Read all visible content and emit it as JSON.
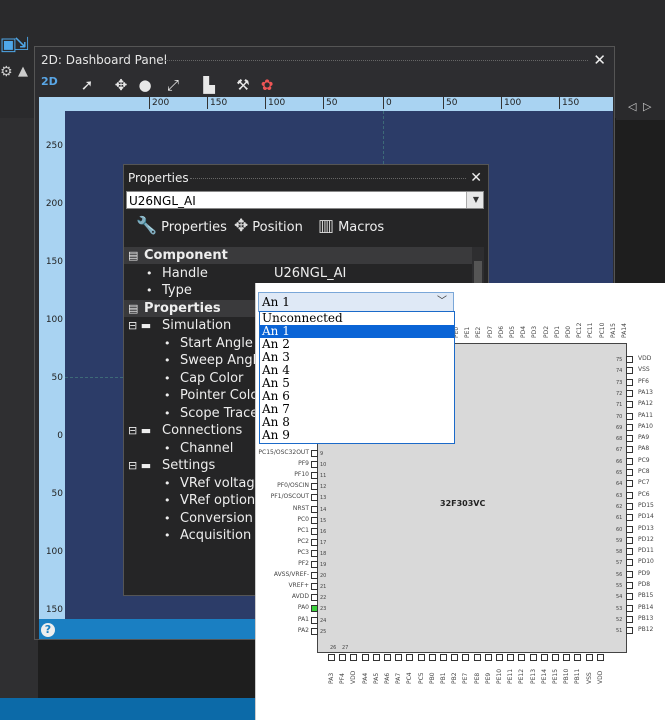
{
  "dashboard": {
    "title": "2D: Dashboard Panel",
    "mode_label": "2D",
    "close_label": "✕",
    "ruler_h_ticks": [
      "200",
      "150",
      "100",
      "50",
      "0",
      "50",
      "100",
      "150"
    ],
    "ruler_v_ticks": [
      "250",
      "200",
      "150",
      "100",
      "50",
      "0",
      "50",
      "100",
      "150"
    ],
    "help_label": "?"
  },
  "properties": {
    "title": "Properties",
    "close_label": "✕",
    "component": "U26NGL_AI",
    "tabs": {
      "properties": "Properties",
      "position": "Position",
      "macros": "Macros"
    },
    "rows": [
      {
        "kind": "cat",
        "label": "Component",
        "indent": 0
      },
      {
        "kind": "item",
        "label": "Handle",
        "value": "U26NGL_AI",
        "indent": 1
      },
      {
        "kind": "item",
        "label": "Type",
        "value": "",
        "indent": 1
      },
      {
        "kind": "cat",
        "label": "Properties",
        "indent": 0
      },
      {
        "kind": "group",
        "label": "Simulation",
        "indent": 0
      },
      {
        "kind": "item",
        "label": "Start Angle",
        "indent": 2
      },
      {
        "kind": "item",
        "label": "Sweep Angle",
        "indent": 2
      },
      {
        "kind": "item",
        "label": "Cap Color",
        "indent": 2
      },
      {
        "kind": "item",
        "label": "Pointer Color",
        "indent": 2
      },
      {
        "kind": "item",
        "label": "Scope Traces",
        "indent": 2
      },
      {
        "kind": "group",
        "label": "Connections",
        "indent": 0
      },
      {
        "kind": "item",
        "label": "Channel",
        "indent": 2
      },
      {
        "kind": "group",
        "label": "Settings",
        "indent": 0
      },
      {
        "kind": "item",
        "label": "VRef voltage",
        "indent": 2
      },
      {
        "kind": "item",
        "label": "VRef option",
        "indent": 2
      },
      {
        "kind": "item",
        "label": "Conversion s.",
        "indent": 2
      },
      {
        "kind": "item",
        "label": "Acquisition c.",
        "indent": 2
      }
    ]
  },
  "dropdown": {
    "selected": "An 1",
    "options": [
      "Unconnected",
      "An 1",
      "An 2",
      "An 3",
      "An 4",
      "An 5",
      "An 6",
      "An 7",
      "An 8",
      "An 9"
    ],
    "highlighted_index": 1
  },
  "chip": {
    "name": "32F303VC",
    "left_pins": [
      {
        "label": "PC15/OSC32OUT",
        "num": "9"
      },
      {
        "label": "PF9",
        "num": "10"
      },
      {
        "label": "PF10",
        "num": "11"
      },
      {
        "label": "PF0/OSCIN",
        "num": "12"
      },
      {
        "label": "PF1/OSCOUT",
        "num": "13"
      },
      {
        "label": "NRST",
        "num": "14"
      },
      {
        "label": "PC0",
        "num": "15"
      },
      {
        "label": "PC1",
        "num": "16"
      },
      {
        "label": "PC2",
        "num": "17"
      },
      {
        "label": "PC3",
        "num": "18"
      },
      {
        "label": "PF2",
        "num": "19"
      },
      {
        "label": "AVSS/VREF-",
        "num": "20"
      },
      {
        "label": "VREF+",
        "num": "21"
      },
      {
        "label": "AVDD",
        "num": "22"
      },
      {
        "label": "PA0",
        "num": "23"
      },
      {
        "label": "PA1",
        "num": "24"
      },
      {
        "label": "PA2",
        "num": "25"
      }
    ],
    "right_pins": [
      {
        "label": "VDD",
        "num": "75"
      },
      {
        "label": "VSS",
        "num": "74"
      },
      {
        "label": "PF6",
        "num": "73"
      },
      {
        "label": "PA13",
        "num": "72"
      },
      {
        "label": "PA12",
        "num": "71"
      },
      {
        "label": "PA11",
        "num": "70"
      },
      {
        "label": "PA10",
        "num": "69"
      },
      {
        "label": "PA9",
        "num": "68"
      },
      {
        "label": "PA8",
        "num": "67"
      },
      {
        "label": "PC9",
        "num": "66"
      },
      {
        "label": "PC8",
        "num": "65"
      },
      {
        "label": "PC7",
        "num": "64"
      },
      {
        "label": "PC6",
        "num": "63"
      },
      {
        "label": "PD15",
        "num": "62"
      },
      {
        "label": "PD14",
        "num": "61"
      },
      {
        "label": "PD13",
        "num": "60"
      },
      {
        "label": "PD12",
        "num": "59"
      },
      {
        "label": "PD11",
        "num": "58"
      },
      {
        "label": "PD10",
        "num": "57"
      },
      {
        "label": "PD9",
        "num": "56"
      },
      {
        "label": "PD8",
        "num": "55"
      },
      {
        "label": "PB15",
        "num": "54"
      },
      {
        "label": "PB14",
        "num": "53"
      },
      {
        "label": "PB13",
        "num": "52"
      },
      {
        "label": "PB12",
        "num": "51"
      }
    ],
    "top_pins": [
      "PE0",
      "PE1",
      "PE2",
      "PD7",
      "PD6",
      "PD5",
      "PD4",
      "PD3",
      "PD2",
      "PD1",
      "PD0",
      "PC12",
      "PC11",
      "PC10",
      "PA15",
      "PA14"
    ],
    "bottom_pins": [
      "PA3",
      "PF4",
      "VDD",
      "PA4",
      "PA5",
      "PA6",
      "PA7",
      "PC4",
      "PC5",
      "PB0",
      "PB1",
      "PB2",
      "PE7",
      "PE8",
      "PE9",
      "PE10",
      "PE11",
      "PE12",
      "PE13",
      "PE14",
      "PE15",
      "PB10",
      "PB11",
      "VSS",
      "VDD"
    ],
    "bottom_nums_prefix": [
      "26",
      "27"
    ]
  }
}
